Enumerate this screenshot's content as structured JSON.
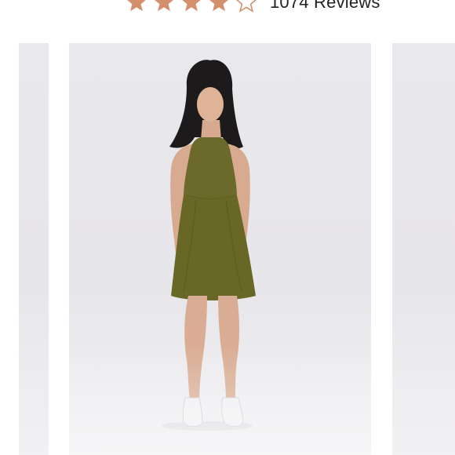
{
  "rating": {
    "filled_stars": 4,
    "total_stars": 5,
    "star_color": "#d4906c",
    "reviews_text": "1074 Reviews"
  },
  "carousel": {
    "active_index": 1,
    "slides": [
      {
        "image": "previous-product-photo"
      },
      {
        "image": "model-in-olive-halter-dress"
      },
      {
        "image": "next-product-photo"
      }
    ]
  },
  "colors": {
    "dress": "#6a6a2a",
    "background": "#e8e7eb"
  }
}
